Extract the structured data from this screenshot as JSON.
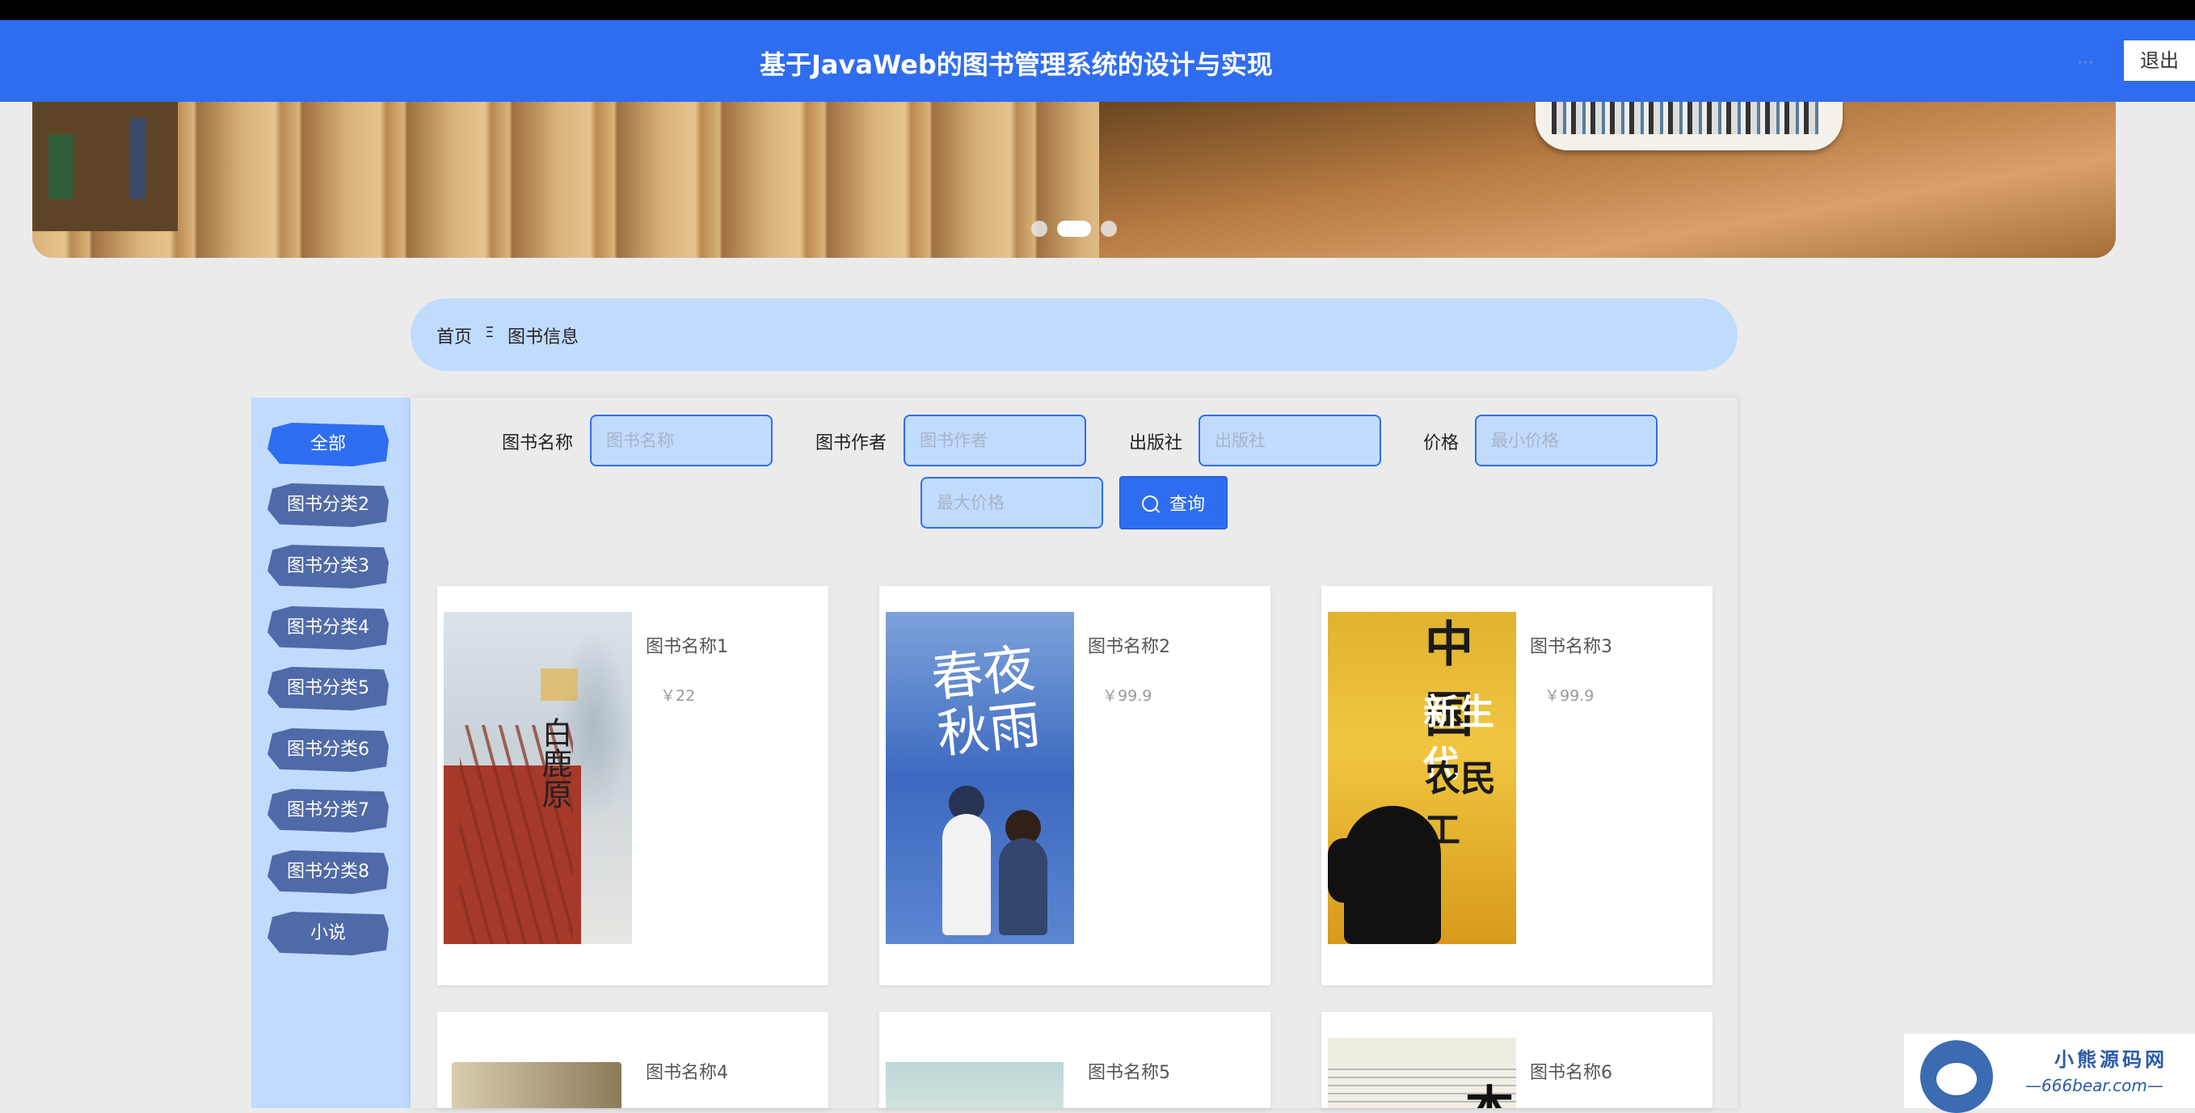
{
  "header": {
    "title": "基于JavaWeb的图书管理系统的设计与实现",
    "logout_label": "退出"
  },
  "breadcrumb": {
    "home": "首页",
    "separator": "Ξ",
    "current": "图书信息"
  },
  "sidebar": {
    "items": [
      {
        "label": "全部",
        "active": true
      },
      {
        "label": "图书分类2"
      },
      {
        "label": "图书分类3"
      },
      {
        "label": "图书分类4"
      },
      {
        "label": "图书分类5"
      },
      {
        "label": "图书分类6"
      },
      {
        "label": "图书分类7"
      },
      {
        "label": "图书分类8"
      },
      {
        "label": "小说"
      }
    ]
  },
  "filters": {
    "name_label": "图书名称",
    "name_placeholder": "图书名称",
    "author_label": "图书作者",
    "author_placeholder": "图书作者",
    "publisher_label": "出版社",
    "publisher_placeholder": "出版社",
    "price_label": "价格",
    "min_price_placeholder": "最小价格",
    "max_price_placeholder": "最大价格",
    "search_label": "查询"
  },
  "books": [
    {
      "name": "图书名称1",
      "price": "￥22",
      "cover_text": "白鹿原"
    },
    {
      "name": "图书名称2",
      "price": "￥99.9",
      "cover_text": "春夜秋雨"
    },
    {
      "name": "图书名称3",
      "price": "￥99.9",
      "cover_text_1": "中国",
      "cover_text_2": "新生代",
      "cover_text_3": "农民工"
    },
    {
      "name": "图书名称4"
    },
    {
      "name": "图书名称5"
    },
    {
      "name": "图书名称6",
      "cover_text": "本"
    }
  ],
  "watermark": {
    "line1": "小熊源码网",
    "line2": "—666bear.com—"
  },
  "colors": {
    "primary": "#2f6df0",
    "light_blue": "#c1dbfe",
    "category_button": "#4f6aa8"
  }
}
